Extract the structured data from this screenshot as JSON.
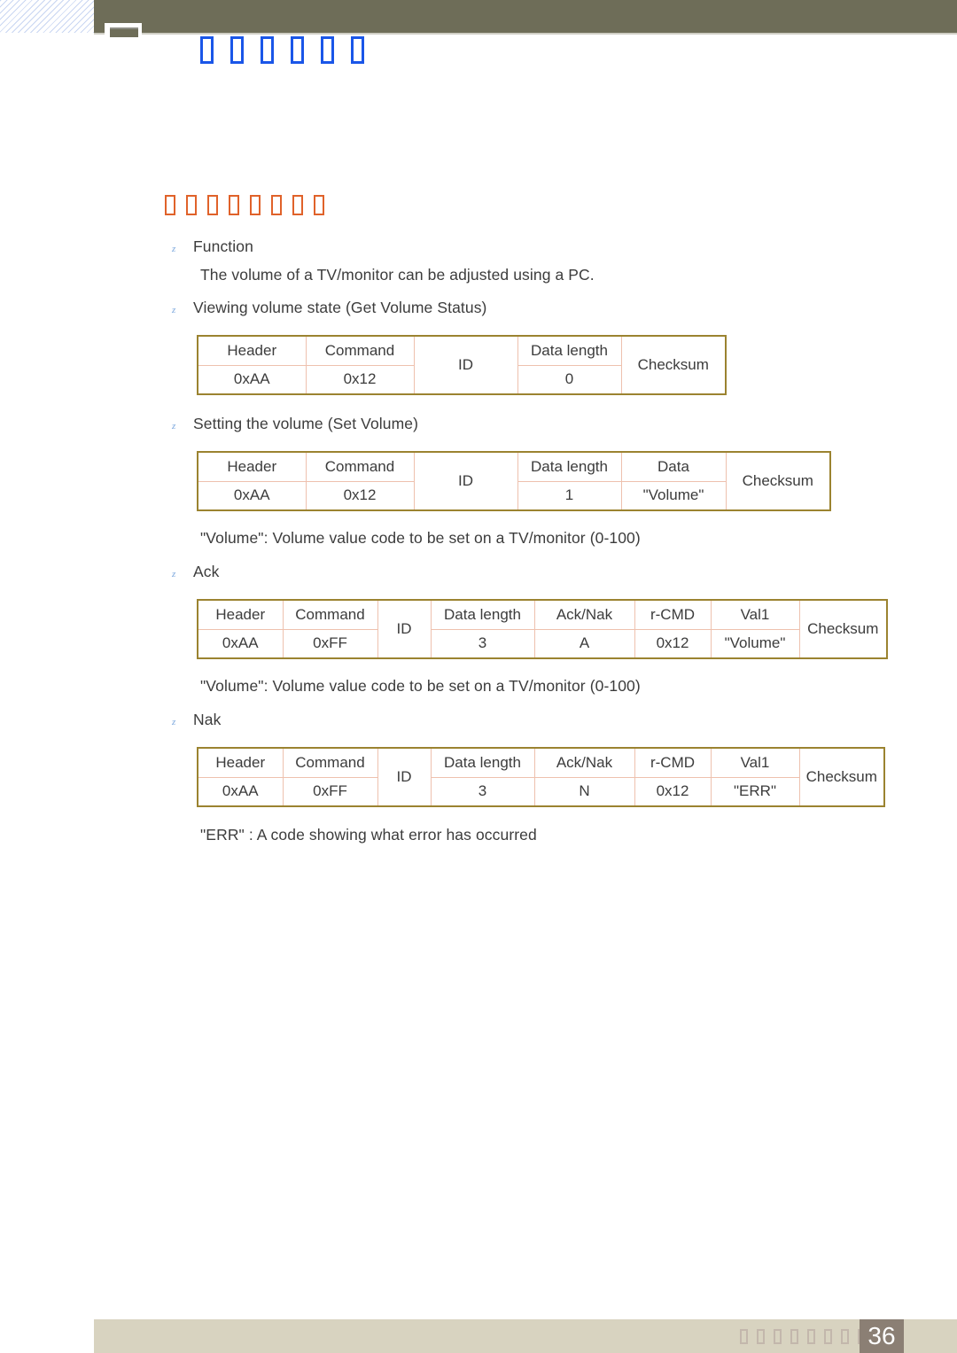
{
  "header": {
    "title_glyphs": [
      "\u0001",
      "\u0001",
      "\u0001",
      "\u0001",
      "\u0001",
      "\u0001"
    ],
    "title_glyph_count": 6,
    "bar_color": "#6e6d58",
    "title_color": "#1a56e8"
  },
  "section": {
    "heading_glyph_count": 8,
    "heading_color": "#e0622a"
  },
  "body": {
    "bullet_function": "Function",
    "text_function_desc": "The volume of a TV/monitor can be adjusted using a PC.",
    "bullet_get_volume": "Viewing volume state (Get Volume Status)",
    "bullet_set_volume": "Setting the volume (Set Volume)",
    "note_volume_1": "\"Volume\": Volume value code to be set on a TV/monitor (0-100)",
    "bullet_ack": "Ack",
    "note_volume_2": "\"Volume\": Volume value code to be set on a TV/monitor (0-100)",
    "bullet_nak": "Nak",
    "note_err": "\"ERR\" : A code showing what error has occurred",
    "bullet_mark": "z"
  },
  "tables": {
    "get_volume_status": {
      "headers": [
        "Header",
        "Command",
        "ID",
        "Data length",
        "Checksum"
      ],
      "values": [
        "0xAA",
        "0x12",
        "",
        "0",
        ""
      ],
      "spanned": [
        "ID",
        "Checksum"
      ]
    },
    "set_volume": {
      "headers": [
        "Header",
        "Command",
        "ID",
        "Data length",
        "Data",
        "Checksum"
      ],
      "values": [
        "0xAA",
        "0x12",
        "",
        "1",
        "\"Volume\"",
        ""
      ],
      "spanned": [
        "ID",
        "Checksum"
      ]
    },
    "ack": {
      "headers": [
        "Header",
        "Command",
        "ID",
        "Data length",
        "Ack/Nak",
        "r-CMD",
        "Val1",
        "Checksum"
      ],
      "values": [
        "0xAA",
        "0xFF",
        "",
        "3",
        "A",
        "0x12",
        "\"Volume\"",
        ""
      ],
      "spanned": [
        "ID",
        "Checksum"
      ]
    },
    "nak": {
      "headers": [
        "Header",
        "Command",
        "ID",
        "Data length",
        "Ack/Nak",
        "r-CMD",
        "Val1",
        "Checksum"
      ],
      "values": [
        "0xAA",
        "0xFF",
        "",
        "3",
        "N",
        "0x12",
        "\"ERR\""
      ],
      "spanned": [
        "ID",
        "Checksum"
      ]
    }
  },
  "footer": {
    "page_number": "36",
    "glyph_count": 9,
    "bar_color": "#d8d3c0",
    "page_box_color": "#8b7f74"
  }
}
